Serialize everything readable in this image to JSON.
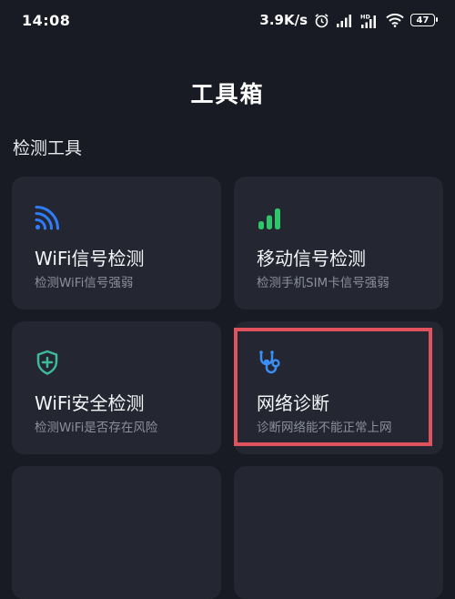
{
  "status_bar": {
    "time": "14:08",
    "net_speed": "3.9K/s",
    "hd_label": "HD",
    "battery": "47",
    "icons": [
      "alarm-icon",
      "signal-icon",
      "hd-signal-icon",
      "wifi-icon",
      "battery-icon"
    ]
  },
  "page": {
    "title": "工具箱"
  },
  "section": {
    "title": "检测工具"
  },
  "tools": [
    {
      "title": "WiFi信号检测",
      "subtitle": "检测WiFi信号强弱",
      "icon": "wifi-signal-icon",
      "color": "#2f7cf6"
    },
    {
      "title": "移动信号检测",
      "subtitle": "检测手机SIM卡信号强弱",
      "icon": "cellular-bars-icon",
      "color": "#2ec66a"
    },
    {
      "title": "WiFi安全检测",
      "subtitle": "检测WiFi是否存在风险",
      "icon": "shield-plus-icon",
      "color": "#3dba9a"
    },
    {
      "title": "网络诊断",
      "subtitle": "诊断网络能不能正常上网",
      "icon": "stethoscope-icon",
      "color": "#3a8ef6"
    }
  ],
  "highlight_color": "#e0535d"
}
